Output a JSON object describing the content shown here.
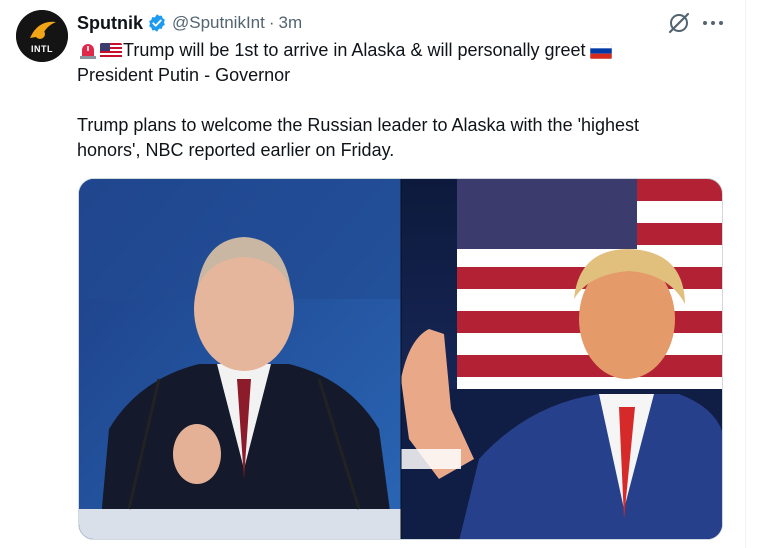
{
  "tweet": {
    "author_name": "Sputnik",
    "handle": "@SputnikInt",
    "separator": "·",
    "time": "3m",
    "avatar_label": "INTL",
    "line1": "Trump will be 1st to arrive in Alaska & will personally greet",
    "line2": "President Putin - Governor",
    "line3": "Trump plans to welcome the Russian leader to Alaska with the 'highest",
    "line4": "honors', NBC reported earlier on Friday.",
    "icons": [
      "siren-emoji",
      "us-flag-emoji",
      "russia-flag-emoji",
      "verified-badge-icon",
      "grok-icon",
      "more-options-icon"
    ],
    "colors": {
      "verified": "#1d9bf0",
      "secondary_text": "#536471",
      "primary_text": "#0f1419"
    }
  },
  "media": {
    "left_photo_subject": "putin-photo",
    "right_photo_subject": "trump-photo"
  }
}
